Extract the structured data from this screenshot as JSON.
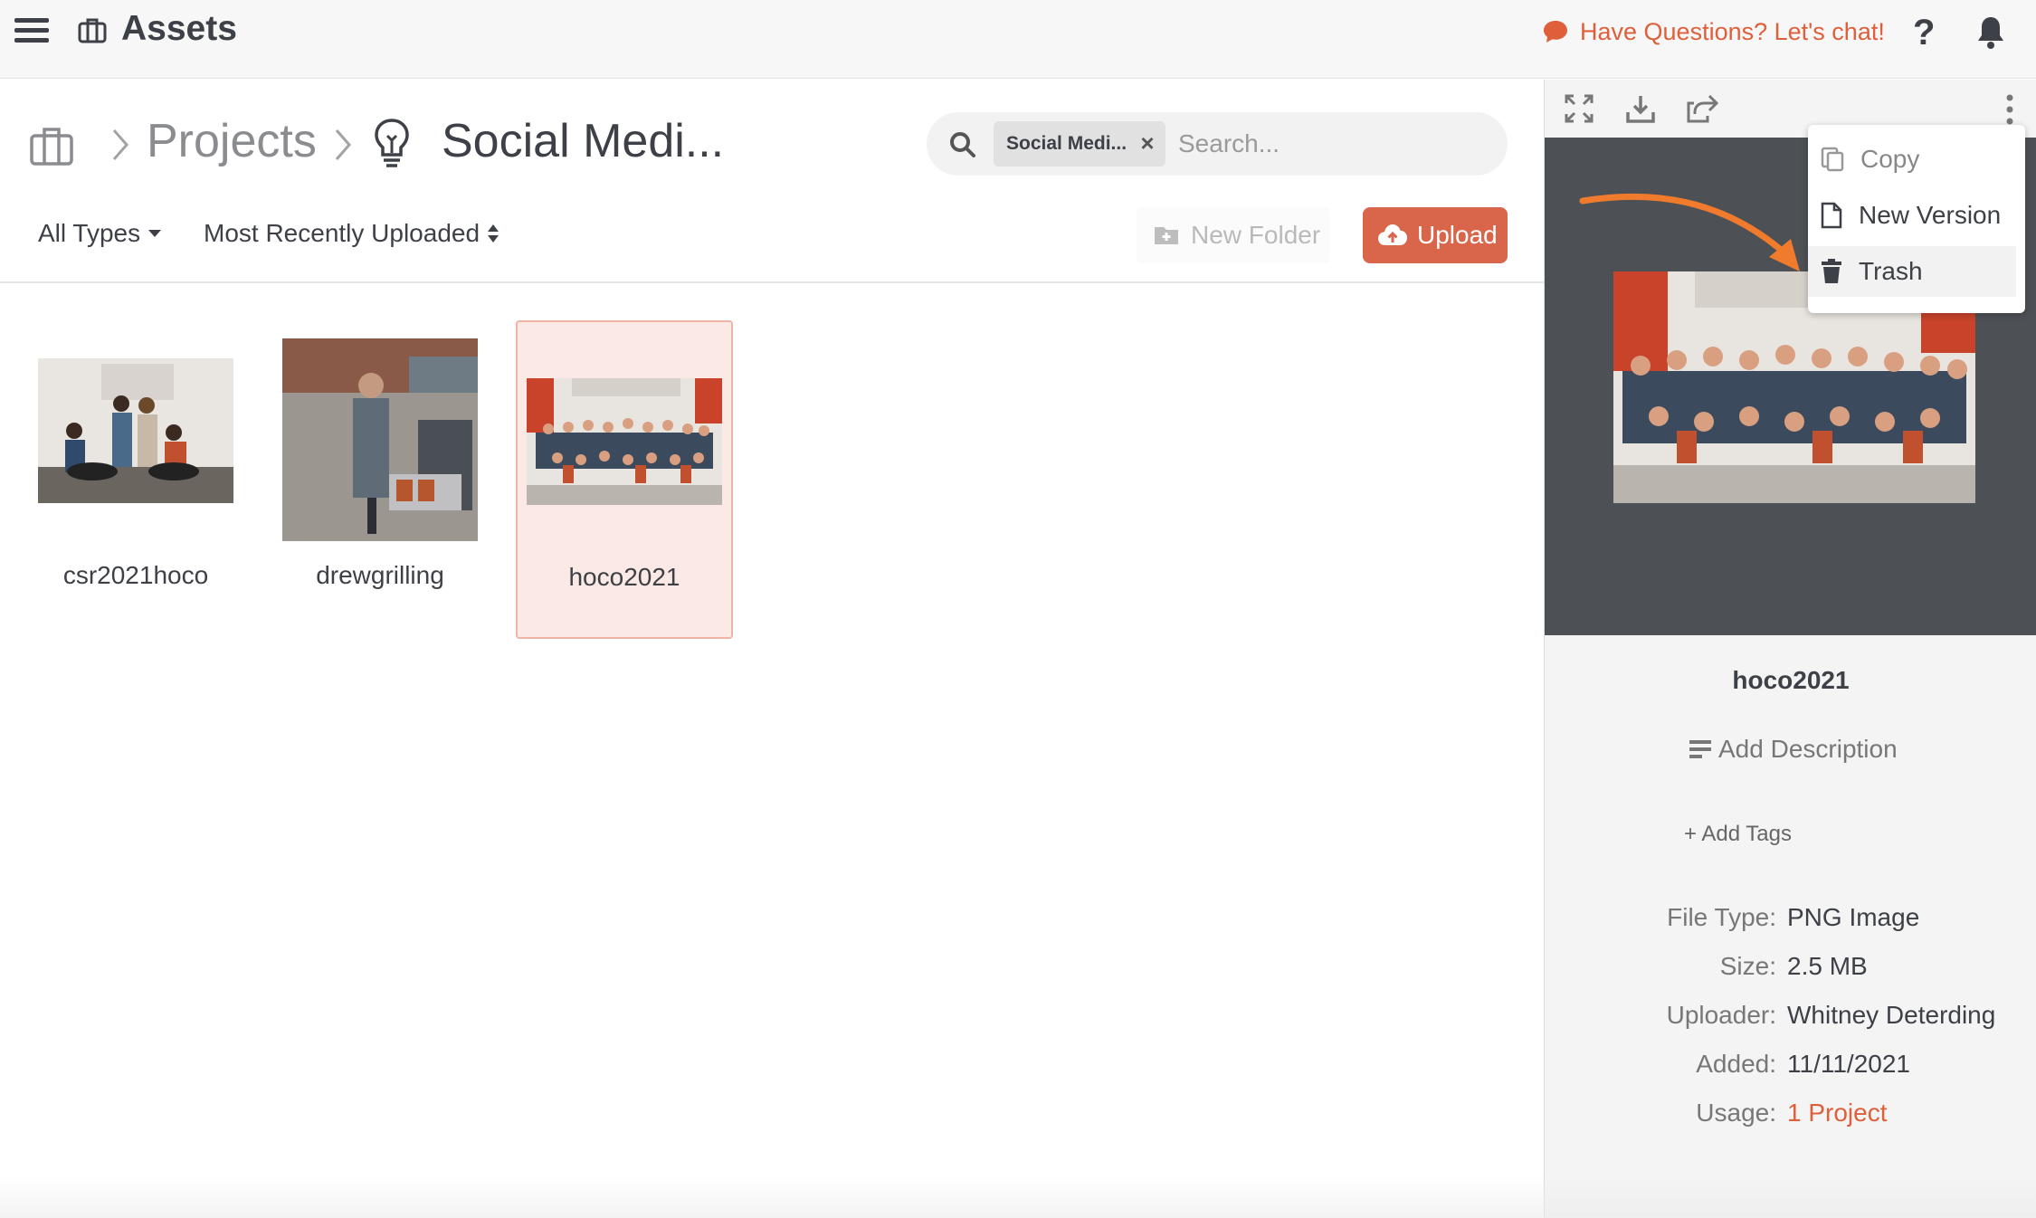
{
  "header": {
    "app_title": "Assets",
    "chat_link": "Have Questions? Let's chat!",
    "help_glyph": "?"
  },
  "breadcrumb": {
    "projects": "Projects",
    "current": "Social Medi..."
  },
  "search": {
    "chip": "Social Medi...",
    "placeholder": "Search..."
  },
  "filters": {
    "type": "All Types",
    "sort": "Most Recently Uploaded"
  },
  "actions": {
    "new_folder": "New Folder",
    "upload": "Upload"
  },
  "assets": [
    {
      "name": "csr2021hoco",
      "selected": false
    },
    {
      "name": "drewgrilling",
      "selected": false
    },
    {
      "name": "hoco2021",
      "selected": true
    }
  ],
  "menu": {
    "items": [
      "Copy",
      "New Version",
      "Trash"
    ]
  },
  "details": {
    "title": "hoco2021",
    "add_description": "Add Description",
    "add_tags": "+ Add Tags",
    "meta": [
      {
        "label": "File Type:",
        "value": "PNG Image"
      },
      {
        "label": "Size:",
        "value": "2.5 MB"
      },
      {
        "label": "Uploader:",
        "value": "Whitney Deterding"
      },
      {
        "label": "Added:",
        "value": "11/11/2021"
      },
      {
        "label": "Usage:",
        "value": "1 Project"
      }
    ]
  },
  "colors": {
    "accent": "#de5f3a",
    "upload_button": "#d9664a",
    "selected_tile": "#fbe9e5",
    "preview_bg": "#4d5155"
  }
}
